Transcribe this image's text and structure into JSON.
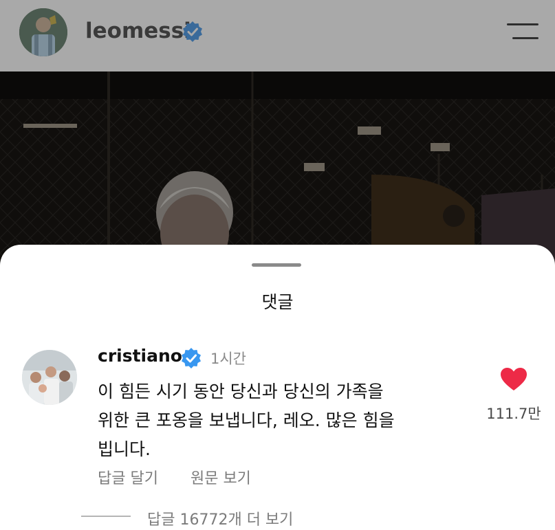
{
  "header": {
    "username": "leomessi",
    "verified_icon": "verified-badge-icon",
    "menu_icon": "hamburger-menu-icon"
  },
  "sheet": {
    "title": "댓글"
  },
  "comment": {
    "username": "cristiano",
    "time": "1시간",
    "text_lines": [
      "이 힘든 시기 동안 당신과 당신의 가족을",
      "위한 큰 포옹을 보냅니다, 레오. 많은 힘을",
      "빕니다."
    ],
    "reply_label": "답글 달기",
    "translate_label": "원문 보기",
    "like_count": "111.7만",
    "view_replies": "답글 16772개 더 보기"
  },
  "colors": {
    "verified": "#3897f0",
    "heart": "#ed2a47",
    "secondary_text": "#7b7b7b"
  }
}
